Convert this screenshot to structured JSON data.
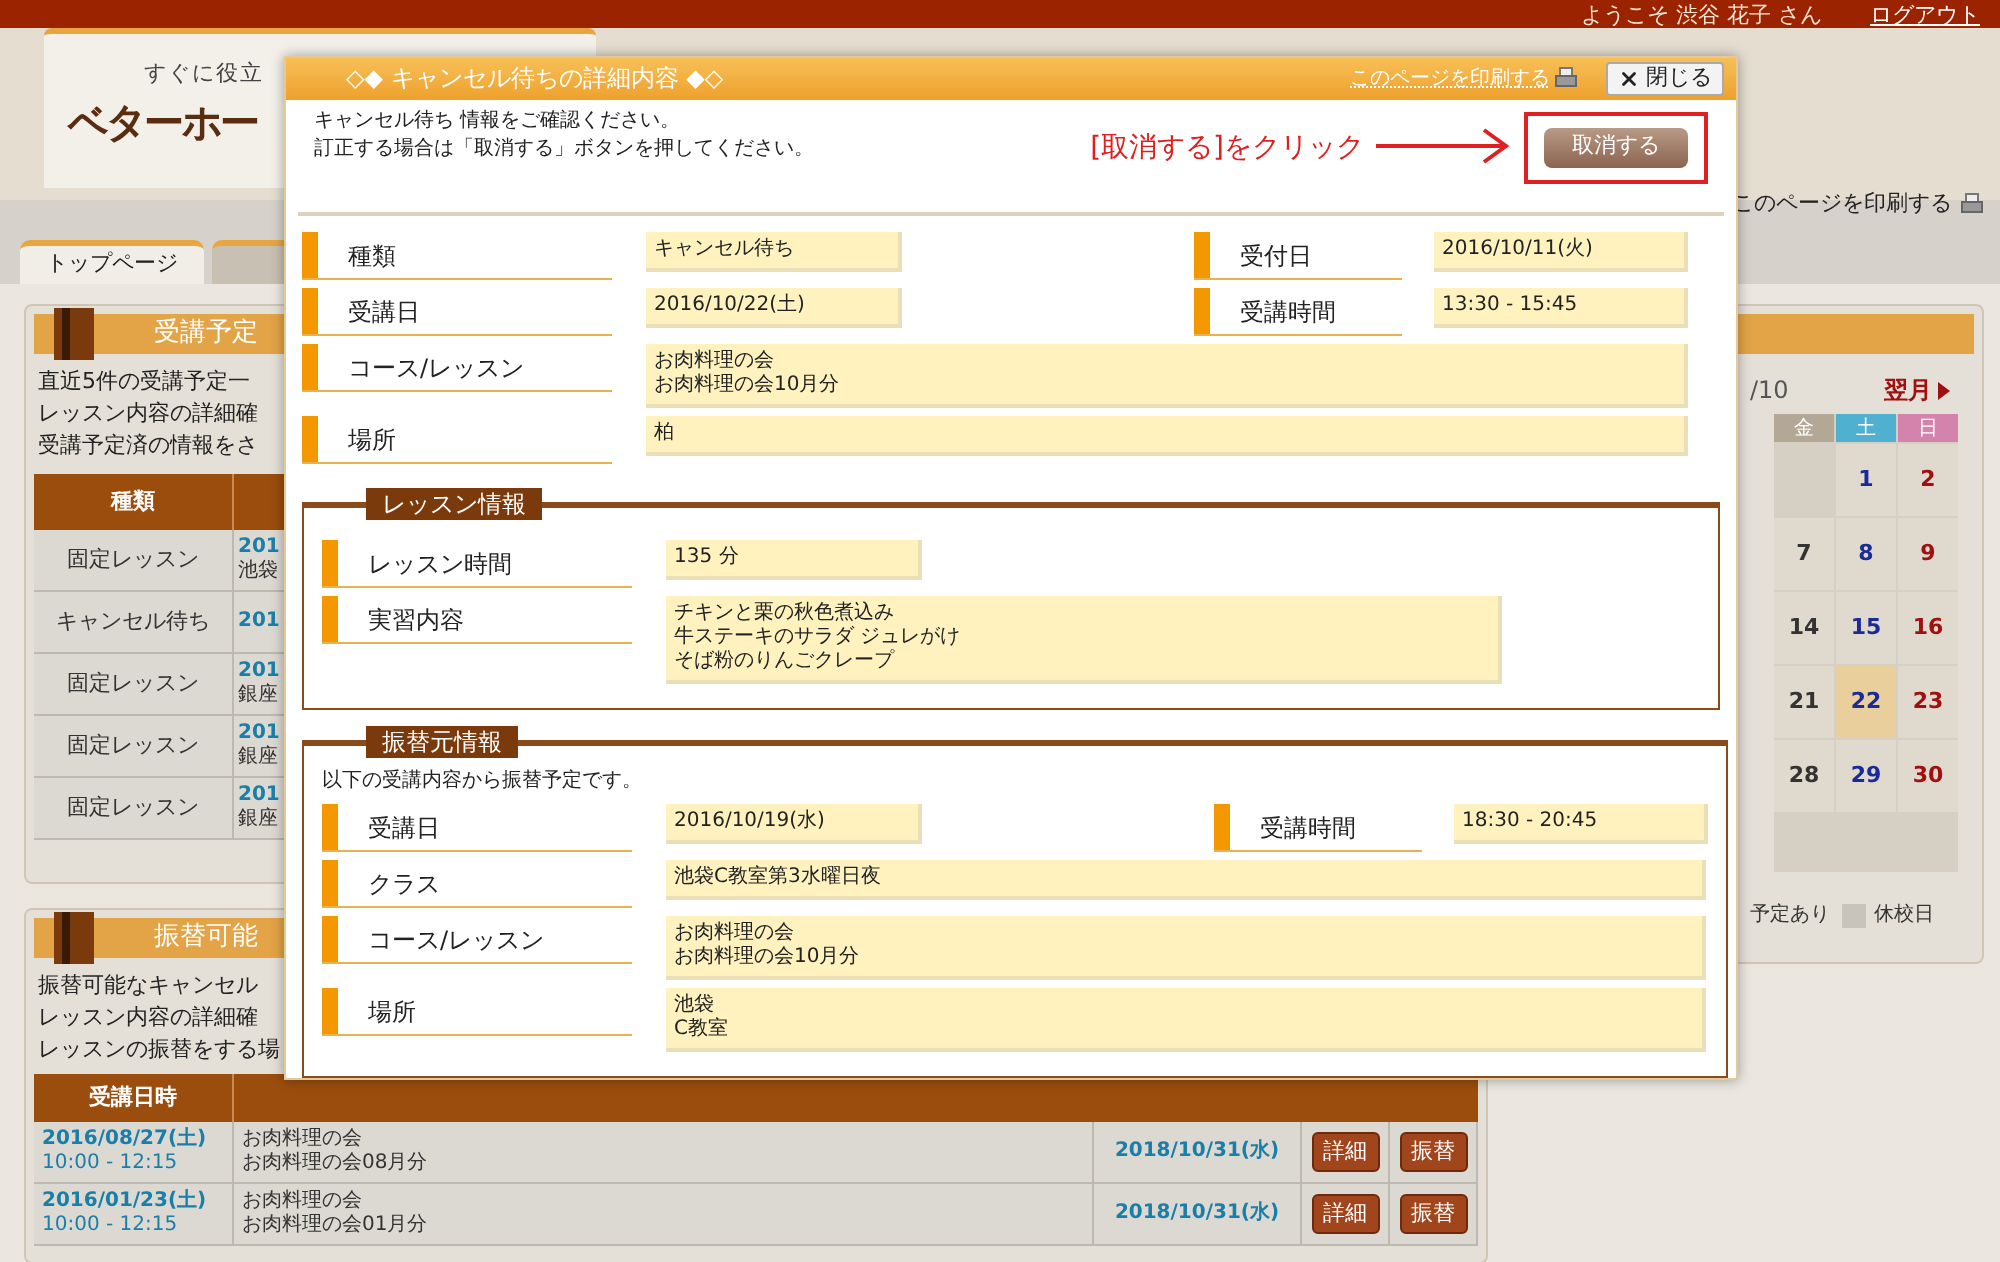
{
  "header": {
    "welcome": "ようこそ 渋谷 花子 さん",
    "logout": "ログアウト",
    "tagline": "すぐに役立",
    "logo": "ベターホー",
    "print": "このページを印刷する"
  },
  "tabs": [
    {
      "label": "トップページ",
      "selected": true
    },
    {
      "selected": false
    }
  ],
  "schedule_panel": {
    "title": "受講予定",
    "lines": [
      "直近5件の受講予定一",
      "レッスン内容の詳細確",
      "受講予定済の情報をさ"
    ],
    "columns": [
      "種類"
    ],
    "rows": [
      {
        "type": "固定レッスン",
        "column_2": [
          "201",
          "池袋"
        ]
      },
      {
        "type": "キャンセル待ち",
        "column_2": [
          "201"
        ]
      },
      {
        "type": "固定レッスン",
        "column_2": [
          "201",
          "銀座"
        ]
      },
      {
        "type": "固定レッスン",
        "column_2": [
          "201",
          "銀座"
        ]
      },
      {
        "type": "固定レッスン",
        "column_2": [
          "201",
          "銀座"
        ]
      }
    ]
  },
  "transfer_panel": {
    "title": "振替可能",
    "lines": [
      "振替可能なキャンセル",
      "レッスン内容の詳細確",
      "レッスンの振替をする場"
    ],
    "columns": [
      "受講日時"
    ],
    "rows": [
      {
        "date": "2016/08/27(土)",
        "time": "10:00 - 12:15",
        "course": [
          "お肉料理の会",
          "お肉料理の会08月分"
        ],
        "deadline": "2018/10/31(水)",
        "buttons": [
          "詳細",
          "振替"
        ]
      },
      {
        "date": "2016/01/23(土)",
        "time": "10:00 - 12:15",
        "course": [
          "お肉料理の会",
          "お肉料理の会01月分"
        ],
        "deadline": "2018/10/31(水)",
        "buttons": [
          "詳細",
          "振替"
        ]
      }
    ]
  },
  "calendar": {
    "month": "/10",
    "next": "翌月",
    "weekdays": [
      {
        "label": "金",
        "kind": "weekday",
        "color": "#b3a896"
      },
      {
        "label": "土",
        "kind": "saturday",
        "color": "#4fb0cf"
      },
      {
        "label": "日",
        "kind": "sunday",
        "color": "#d483ad"
      }
    ],
    "weeks": [
      [
        {
          "kind": "blank"
        },
        {
          "kind": "day",
          "day": "1",
          "selected": false
        },
        {
          "kind": "day",
          "day": "2",
          "selected": false
        }
      ],
      [
        {
          "kind": "day",
          "day": "7",
          "selected": false
        },
        {
          "kind": "day",
          "day": "8",
          "selected": false
        },
        {
          "kind": "day",
          "day": "9",
          "selected": false
        }
      ],
      [
        {
          "kind": "day",
          "day": "14",
          "selected": false
        },
        {
          "kind": "day",
          "day": "15",
          "selected": false
        },
        {
          "kind": "day",
          "day": "16",
          "selected": false
        }
      ],
      [
        {
          "kind": "day",
          "day": "21",
          "selected": false
        },
        {
          "kind": "day",
          "day": "22",
          "selected": true
        },
        {
          "kind": "day",
          "day": "23",
          "selected": false
        }
      ],
      [
        {
          "kind": "day",
          "day": "28",
          "selected": false
        },
        {
          "kind": "day",
          "day": "29",
          "selected": false
        },
        {
          "kind": "day",
          "day": "30",
          "selected": false
        }
      ]
    ],
    "legend": [
      {
        "label": "予定あり",
        "kind": "text"
      },
      {
        "label": "休校日",
        "kind": "swatch"
      }
    ]
  },
  "modal": {
    "title": "◇◆ キャンセル待ちの詳細内容 ◆◇",
    "print": "このページを印刷する",
    "close": "閉じる",
    "instructions": [
      "キャンセル待ち 情報をご確認ください。",
      "訂正する場合は「取消する」ボタンを押してください。"
    ],
    "annotation": "[取消する]をクリック",
    "cancel_button": "取消する",
    "fields": [
      {
        "label": "種類",
        "value": [
          "キャンセル待ち"
        ],
        "kind": "short",
        "side": {
          "label": "受付日",
          "value": "2016/10/11(火)"
        }
      },
      {
        "label": "受講日",
        "value": [
          "2016/10/22(土)"
        ],
        "kind": "short",
        "side": {
          "label": "受講時間",
          "value": "13:30 - 15:45"
        }
      },
      {
        "label": "コース/レッスン",
        "value": [
          "お肉料理の会",
          "お肉料理の会10月分"
        ],
        "kind": "full"
      },
      {
        "label": "場所",
        "value": [
          "柏"
        ],
        "kind": "full"
      }
    ],
    "sections": [
      {
        "title": "レッスン情報",
        "fields": [
          {
            "label": "レッスン時間",
            "value": [
              "135 分"
            ],
            "kind": "short"
          },
          {
            "label": "実習内容",
            "value": [
              "チキンと栗の秋色煮込み",
              "牛ステーキのサラダ ジュレがけ",
              "そば粉のりんごクレープ"
            ],
            "kind": "medium"
          }
        ]
      },
      {
        "title": "振替元情報",
        "note": "以下の受講内容から振替予定です。",
        "fields": [
          {
            "label": "受講日",
            "value": [
              "2016/10/19(水)"
            ],
            "kind": "short",
            "side": {
              "label": "受講時間",
              "value": "18:30 - 20:45"
            }
          },
          {
            "label": "クラス",
            "value": [
              "池袋C教室第3水曜日夜"
            ],
            "kind": "full"
          },
          {
            "label": "コース/レッスン",
            "value": [
              "お肉料理の会",
              "お肉料理の会10月分"
            ],
            "kind": "full"
          },
          {
            "label": "場所",
            "value": [
              "池袋",
              "C教室"
            ],
            "kind": "full"
          }
        ]
      }
    ]
  }
}
